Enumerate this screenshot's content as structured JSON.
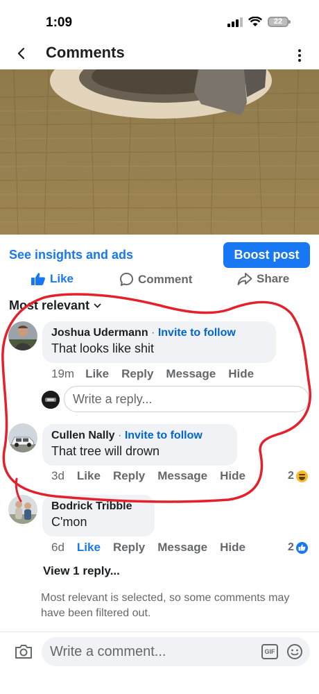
{
  "status_bar": {
    "time": "1:09",
    "battery": "22"
  },
  "header": {
    "title": "Comments"
  },
  "post_actions": {
    "insights_label": "See insights and ads",
    "boost_label": "Boost post",
    "like_label": "Like",
    "comment_label": "Comment",
    "share_label": "Share"
  },
  "sort": {
    "label": "Most relevant"
  },
  "comments": [
    {
      "author": "Joshua Udermann",
      "invite": "Invite to follow",
      "text": "That looks like shit",
      "time": "19m",
      "like_label": "Like",
      "reply_label": "Reply",
      "message_label": "Message",
      "hide_label": "Hide"
    },
    {
      "author": "Cullen Nally",
      "invite": "Invite to follow",
      "text": "That tree will drown",
      "time": "3d",
      "like_label": "Like",
      "reply_label": "Reply",
      "message_label": "Message",
      "hide_label": "Hide",
      "reaction_count": "2"
    },
    {
      "author": "Bodrick Tribble",
      "text": "C'mon",
      "time": "6d",
      "like_label": "Like",
      "reply_label": "Reply",
      "message_label": "Message",
      "hide_label": "Hide",
      "reaction_count": "2"
    }
  ],
  "reply_box": {
    "placeholder": "Write a reply..."
  },
  "view_replies": "View 1 reply...",
  "filter_note": "Most relevant is selected, so some comments may have been filtered out.",
  "composer": {
    "placeholder": "Write a comment...",
    "gif_label": "GIF"
  },
  "colors": {
    "accent": "#1877f2",
    "annotation": "#e5202a"
  }
}
